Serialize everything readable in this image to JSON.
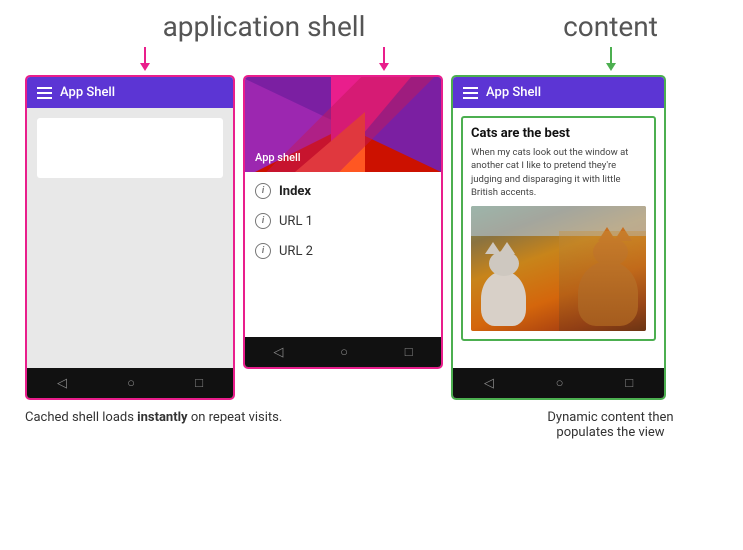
{
  "labels": {
    "application_shell": "application shell",
    "content": "content"
  },
  "phone1": {
    "appbar_title": "App Shell",
    "content_placeholder": ""
  },
  "phone2": {
    "appbar_title": "App shell",
    "menu_items": [
      {
        "label": "Index",
        "bold": true
      },
      {
        "label": "URL 1",
        "bold": false
      },
      {
        "label": "URL 2",
        "bold": false
      }
    ]
  },
  "phone3": {
    "appbar_title": "App Shell",
    "content_title": "Cats are the best",
    "content_text": "When my cats look out the window at another cat I like to pretend they're judging and disparaging it with little British accents."
  },
  "captions": {
    "left_part1": "Cached shell loads ",
    "left_bold": "instantly",
    "left_part2": " on repeat visits.",
    "right_line1": "Dynamic content then",
    "right_line2": "populates the view"
  },
  "nav_icons": {
    "back": "◁",
    "home": "○",
    "recent": "□"
  }
}
